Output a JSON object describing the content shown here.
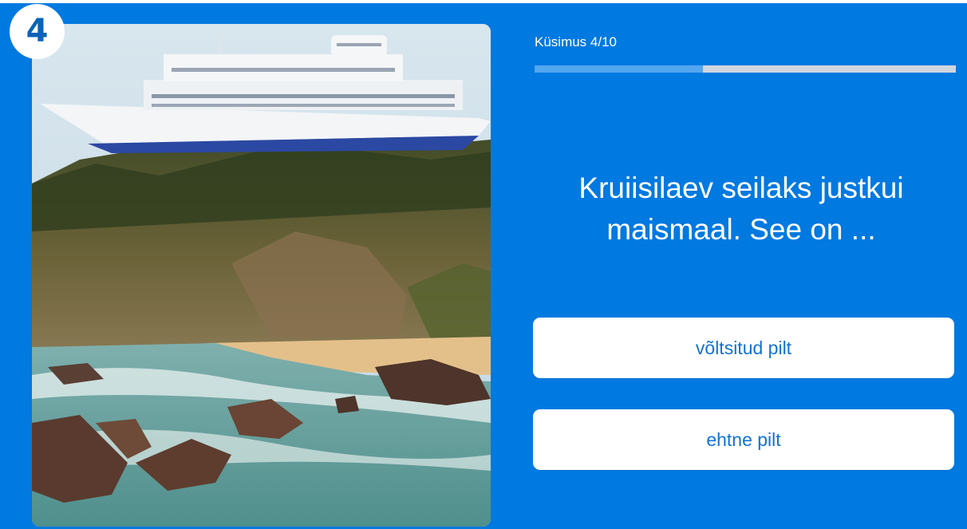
{
  "quiz": {
    "question_number": "4",
    "progress_label": "Küsimus 4/10",
    "progress": {
      "current": 4,
      "total": 10,
      "fraction": 0.4
    },
    "question": "Kruiisilaev seilaks justkui maismaal. See on ...",
    "answers": [
      {
        "label": "võltsitud pilt"
      },
      {
        "label": "ehtne pilt"
      }
    ]
  },
  "colors": {
    "background": "#0079e0",
    "progress_fill": "#53a6ef",
    "progress_track": "#cfd6de",
    "button_text": "#1273d3",
    "badge_text": "#0b63b5"
  },
  "icons": {
    "photo": "cruise-ship-on-cliff-photo"
  }
}
